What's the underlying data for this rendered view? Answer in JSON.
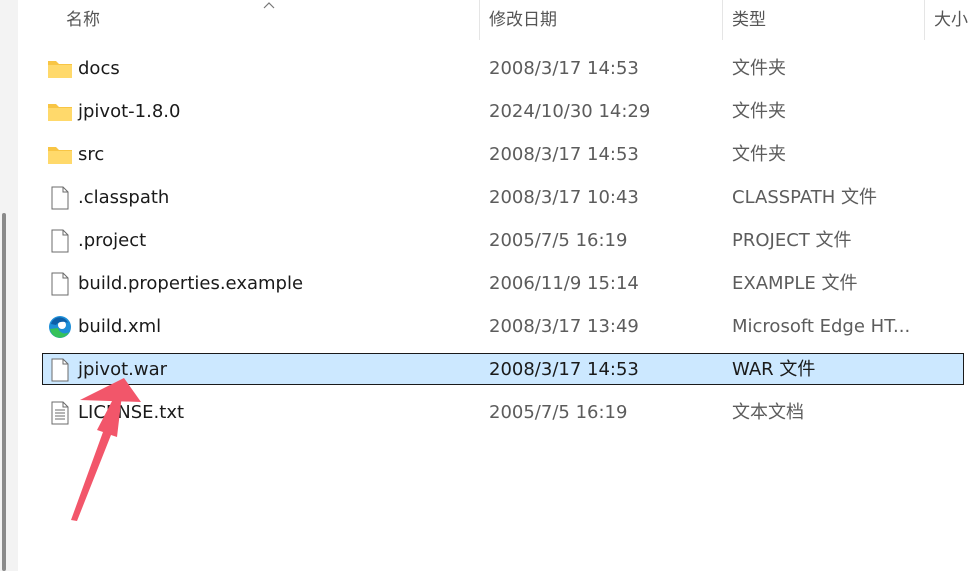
{
  "header": {
    "name": "名称",
    "modified": "修改日期",
    "type": "类型",
    "size": "大小"
  },
  "files": [
    {
      "name": "docs",
      "date": "2008/3/17 14:53",
      "type": "文件夹",
      "icon": "folder-icon"
    },
    {
      "name": "jpivot-1.8.0",
      "date": "2024/10/30 14:29",
      "type": "文件夹",
      "icon": "folder-icon"
    },
    {
      "name": "src",
      "date": "2008/3/17 14:53",
      "type": "文件夹",
      "icon": "folder-icon"
    },
    {
      "name": ".classpath",
      "date": "2008/3/17 10:43",
      "type": "CLASSPATH 文件",
      "icon": "file-icon"
    },
    {
      "name": ".project",
      "date": "2005/7/5 16:19",
      "type": "PROJECT 文件",
      "icon": "file-icon"
    },
    {
      "name": "build.properties.example",
      "date": "2006/11/9 15:14",
      "type": "EXAMPLE 文件",
      "icon": "file-icon"
    },
    {
      "name": "build.xml",
      "date": "2008/3/17 13:49",
      "type": "Microsoft Edge HT...",
      "icon": "edge-icon"
    },
    {
      "name": "jpivot.war",
      "date": "2008/3/17 14:53",
      "type": "WAR 文件",
      "icon": "file-icon",
      "selected": true
    },
    {
      "name": "LICENSE.txt",
      "date": "2005/7/5 16:19",
      "type": "文本文档",
      "icon": "text-file-icon"
    }
  ],
  "colors": {
    "selection": "#cce8ff",
    "folder": "#f8c544",
    "annotation_arrow": "#f2566a"
  }
}
